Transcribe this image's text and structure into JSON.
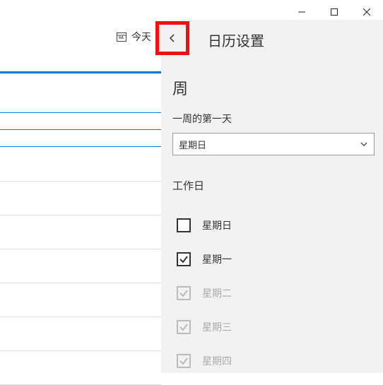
{
  "titlebar": {
    "minimize_icon": "minimize-icon",
    "maximize_icon": "maximize-icon",
    "close_icon": "close-icon"
  },
  "toolbar": {
    "today_label": "今天"
  },
  "panel": {
    "title": "日历设置",
    "week": {
      "section_title": "周",
      "first_day_label": "一周的第一天",
      "first_day_value": "星期日",
      "workdays_label": "工作日",
      "days": [
        {
          "label": "星期日",
          "checked": false,
          "disabled": false
        },
        {
          "label": "星期一",
          "checked": true,
          "disabled": false
        },
        {
          "label": "星期二",
          "checked": true,
          "disabled": true
        },
        {
          "label": "星期三",
          "checked": true,
          "disabled": true
        },
        {
          "label": "星期四",
          "checked": true,
          "disabled": true
        }
      ]
    }
  }
}
